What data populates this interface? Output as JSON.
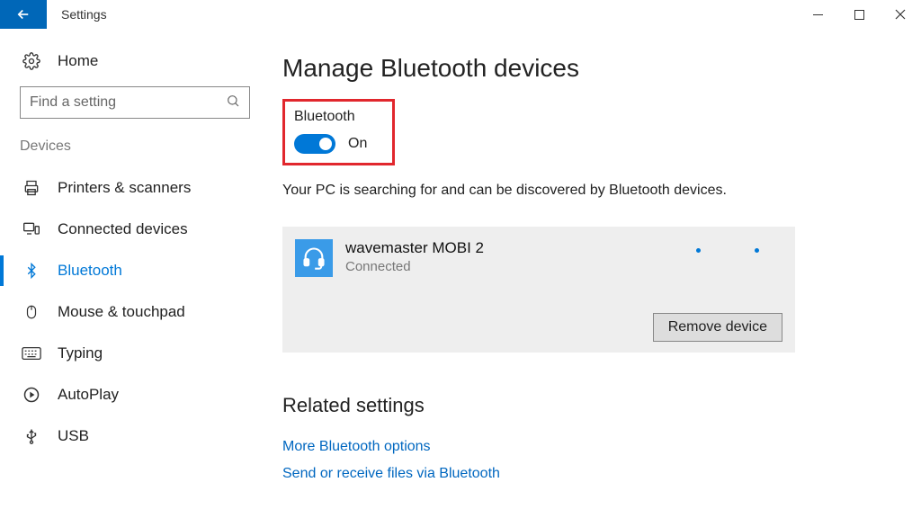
{
  "titlebar": {
    "app_title": "Settings"
  },
  "sidebar": {
    "home_label": "Home",
    "search_placeholder": "Find a setting",
    "section_label": "Devices",
    "items": [
      {
        "label": "Printers & scanners"
      },
      {
        "label": "Connected devices"
      },
      {
        "label": "Bluetooth"
      },
      {
        "label": "Mouse & touchpad"
      },
      {
        "label": "Typing"
      },
      {
        "label": "AutoPlay"
      },
      {
        "label": "USB"
      }
    ]
  },
  "main": {
    "heading": "Manage Bluetooth devices",
    "bluetooth_label": "Bluetooth",
    "toggle_state": "On",
    "status_text": "Your PC is searching for and can be discovered by Bluetooth devices.",
    "device": {
      "name": "wavemaster MOBI 2",
      "status": "Connected",
      "remove_label": "Remove device"
    },
    "related": {
      "heading": "Related settings",
      "links": [
        "More Bluetooth options",
        "Send or receive files via Bluetooth"
      ]
    }
  }
}
